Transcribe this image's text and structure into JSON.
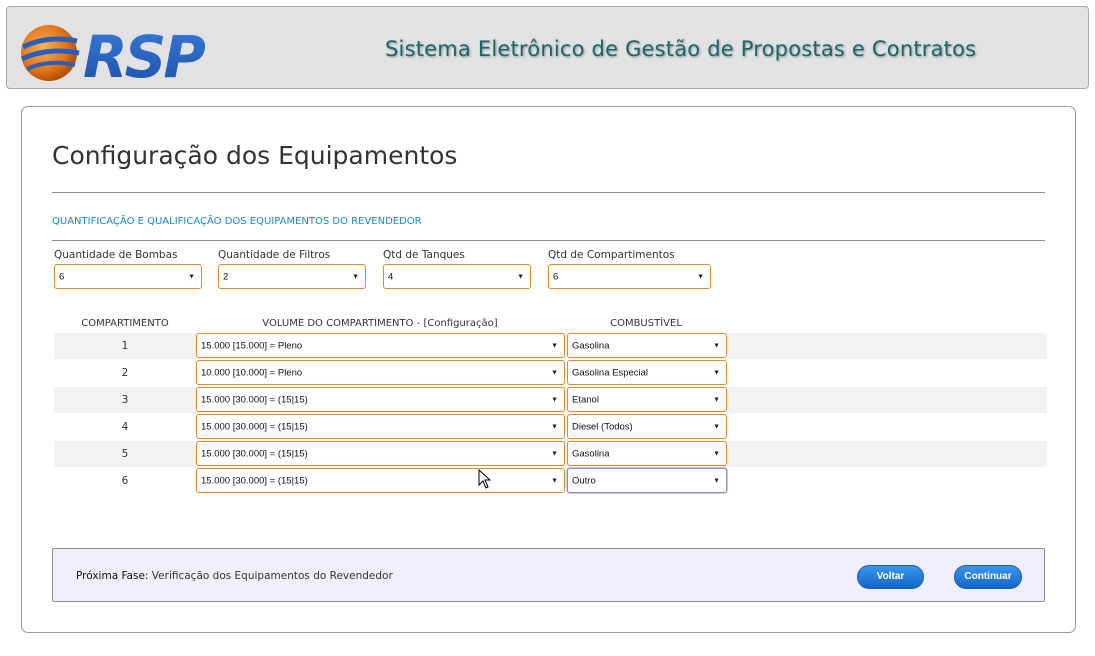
{
  "header": {
    "logo_text": "RSP",
    "title": "Sistema Eletrônico de Gestão de Propostas e Contratos"
  },
  "page": {
    "title": "Configuração dos Equipamentos",
    "section_title": "QUANTIFICAÇÃO E QUALIFICAÇÃO DOS EQUIPAMENTOS DO REVENDEDOR"
  },
  "fields": [
    {
      "label": "Quantidade de Bombas",
      "value": "6"
    },
    {
      "label": "Quantidade de Filtros",
      "value": "2"
    },
    {
      "label": "Qtd de Tanques",
      "value": "4"
    },
    {
      "label": "Qtd de Compartimentos",
      "value": "6"
    }
  ],
  "table": {
    "headers": {
      "compartimento": "COMPARTIMENTO",
      "volume": "VOLUME DO COMPARTIMENTO - [Configuração]",
      "combustivel": "COMBUSTÍVEL"
    },
    "rows": [
      {
        "num": "1",
        "volume": "15.000 [15.000] = Pleno",
        "combustivel": "Gasolina"
      },
      {
        "num": "2",
        "volume": "10.000 [10.000] = Pleno",
        "combustivel": "Gasolina Especial"
      },
      {
        "num": "3",
        "volume": "15.000 [30.000] = (15|15)",
        "combustivel": "Etanol"
      },
      {
        "num": "4",
        "volume": "15.000 [30.000] = (15|15)",
        "combustivel": "Diesel (Todos)"
      },
      {
        "num": "5",
        "volume": "15.000 [30.000] = (15|15)",
        "combustivel": "Gasolina"
      },
      {
        "num": "6",
        "volume": "15.000 [30.000] = (15|15)",
        "combustivel": "Outro"
      }
    ]
  },
  "footer": {
    "next_label": "Próxima Fase:",
    "next_value": "Verificação dos Equipamentos do Revendedor",
    "back_button": "Voltar",
    "continue_button": "Continuar"
  },
  "colors": {
    "accent_orange": "#e08a2c",
    "section_blue": "#1b87c9",
    "header_teal": "#17676f",
    "button_blue": "#1a73d6"
  }
}
